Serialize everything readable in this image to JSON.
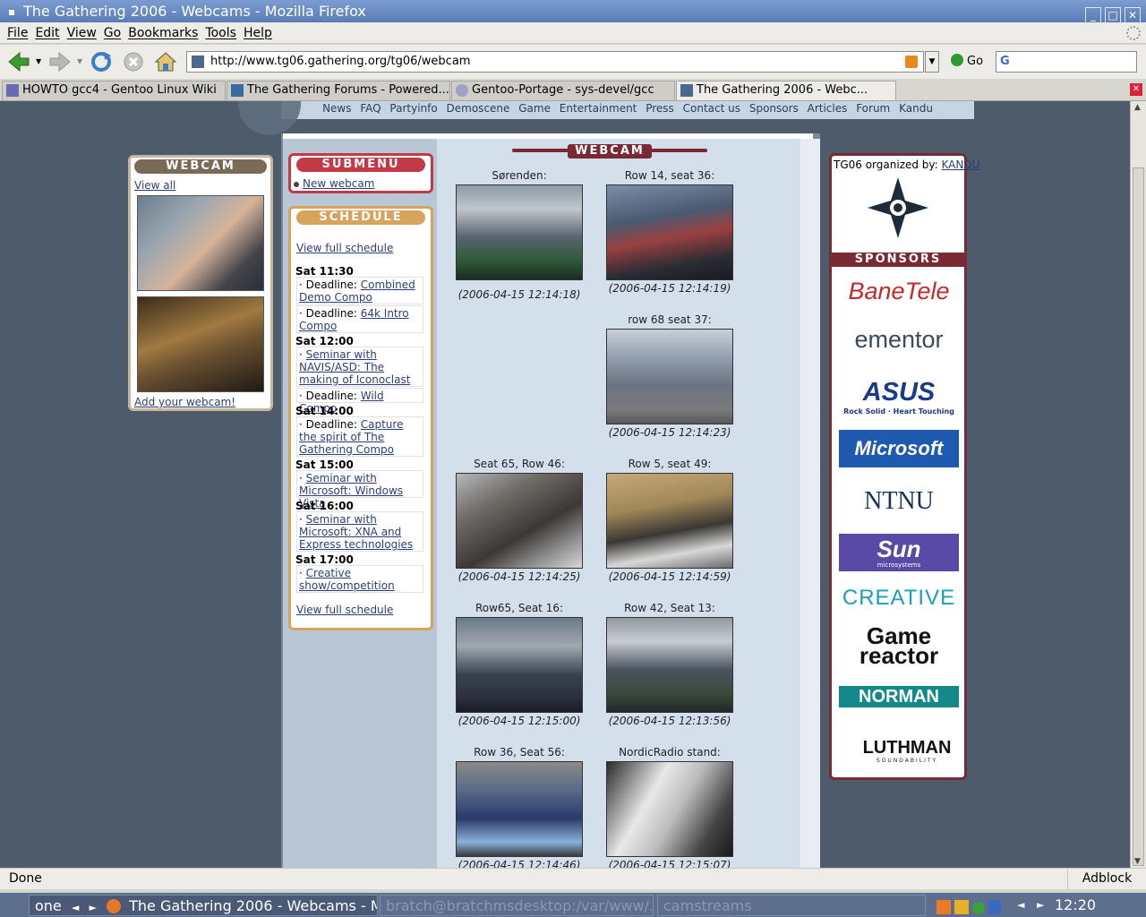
{
  "window": {
    "title": "The Gathering 2006 - Webcams - Mozilla Firefox"
  },
  "menu": [
    "File",
    "Edit",
    "View",
    "Go",
    "Bookmarks",
    "Tools",
    "Help"
  ],
  "toolbar": {
    "url": "http://www.tg06.gathering.org/tg06/webcam",
    "go_label": "Go",
    "search_value": "G"
  },
  "tabs": [
    {
      "label": "HOWTO gcc4 - Gentoo Linux Wiki"
    },
    {
      "label": "The Gathering Forums - Powered..."
    },
    {
      "label": "Gentoo-Portage - sys-devel/gcc"
    },
    {
      "label": "The Gathering 2006 - Webc..."
    }
  ],
  "site_nav": [
    "News",
    "FAQ",
    "Partyinfo",
    "Demoscene",
    "Game",
    "Entertainment",
    "Press",
    "Contact us",
    "Sponsors",
    "Articles",
    "Forum",
    "Kandu"
  ],
  "left_webcam": {
    "title": "WEBCAM",
    "view_all": "View all",
    "add": "Add your webcam!"
  },
  "submenu": {
    "title": "SUBMENU",
    "item": "New webcam"
  },
  "schedule": {
    "title": "SCHEDULE",
    "link_top": "View full schedule",
    "link_bottom": "View full schedule",
    "t1": "Sat 11:30",
    "e1": {
      "prefix": "· Deadline: ",
      "link": "Combined Demo Compo"
    },
    "e2": {
      "prefix": "· Deadline: ",
      "link": "64k Intro Compo"
    },
    "t2": "Sat 12:00",
    "e3": {
      "prefix": "· ",
      "link": "Seminar with NAVIS/ASD: The making of Iconoclast"
    },
    "e4": {
      "prefix": "· Deadline: ",
      "link": "Wild Compo"
    },
    "t3": "Sat 14:00",
    "e5": {
      "prefix": "· Deadline: ",
      "link": "Capture the spirit of The Gathering Compo"
    },
    "t4": "Sat 15:00",
    "e6": {
      "prefix": "· ",
      "link": "Seminar with Microsoft: Windows Vista"
    },
    "t5": "Sat 16:00",
    "e7": {
      "prefix": "· ",
      "link": "Seminar with Microsoft: XNA and Express technologies"
    },
    "t6": "Sat 17:00",
    "e8": {
      "prefix": "· ",
      "link": "Creative show/competition"
    }
  },
  "webcam_heading": "WEBCAM",
  "cams": [
    {
      "caption": "Sørenden:",
      "time": "(2006-04-15 12:14:18)"
    },
    {
      "caption": "Row 14, seat 36:",
      "time": "(2006-04-15 12:14:19)"
    },
    {
      "caption": "row 68 seat 37:",
      "time": "(2006-04-15 12:14:23)"
    },
    {
      "caption": "Seat 65, Row 46:",
      "time": "(2006-04-15 12:14:25)"
    },
    {
      "caption": "Row 5, seat 49:",
      "time": "(2006-04-15 12:14:59)"
    },
    {
      "caption": "Row65, Seat 16:",
      "time": "(2006-04-15 12:15:00)"
    },
    {
      "caption": "Row 42, Seat 13:",
      "time": "(2006-04-15 12:13:56)"
    },
    {
      "caption": "Row 36, Seat 56:",
      "time": "(2006-04-15 12:14:46)"
    },
    {
      "caption": "NordicRadio stand:",
      "time": "(2006-04-15 12:15:07)"
    }
  ],
  "sidebar": {
    "org_prefix": "TG06 organized by: ",
    "org_link": "KANDU",
    "sponsors_title": "SPONSORS",
    "sponsors": [
      "BaneTele",
      "ementor",
      "ASUS",
      "Rock Solid · Heart Touching",
      "Microsoft",
      "NTNU",
      "Sun",
      "microsystems",
      "CREATIVE",
      "Game",
      "reactor",
      "NORMAN",
      "LUTHMAN",
      "SOUNDABILITY"
    ]
  },
  "status": {
    "text": "Done",
    "adblock": "Adblock"
  },
  "taskbar": {
    "left": "one",
    "task1": "The Gathering 2006 - Webcams - M",
    "task2": "bratch@bratchmsdesktop:/var/www/...",
    "task3": "camstreams",
    "clock": "12:20"
  }
}
